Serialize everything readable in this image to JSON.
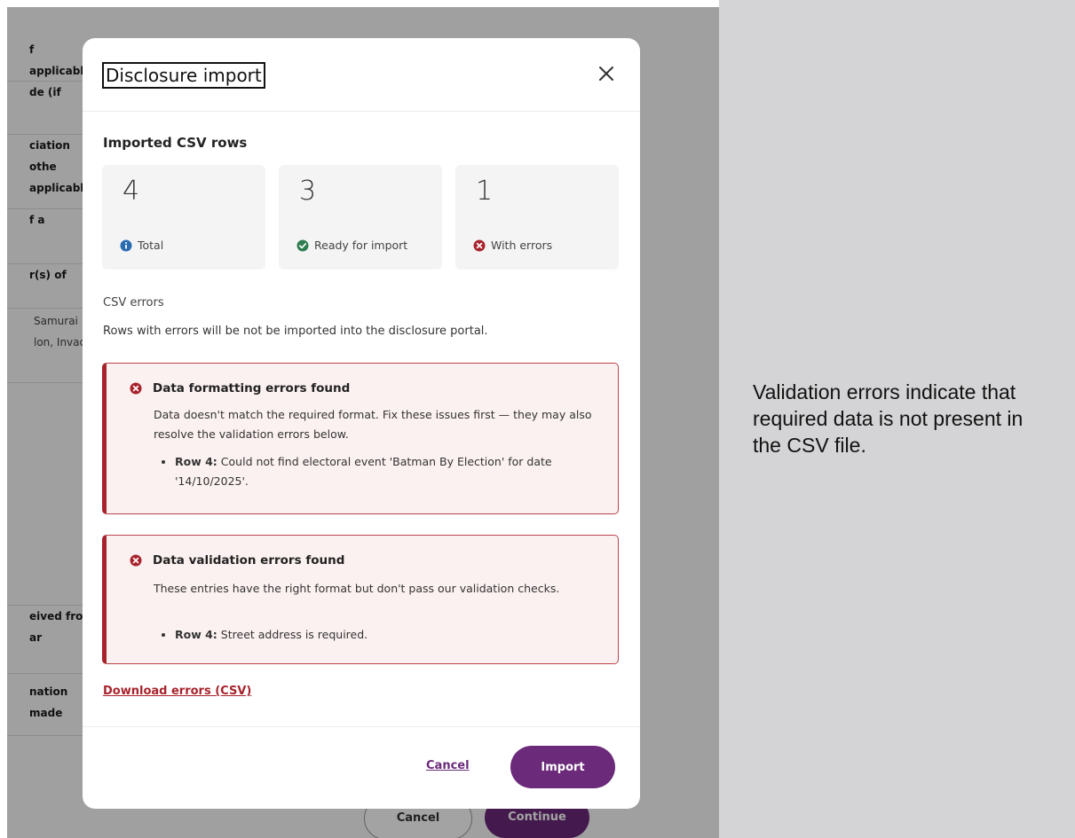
{
  "background_form": {
    "rows": [
      {
        "text": "f applicable)"
      },
      {
        "text": "de (if"
      },
      {
        "text": "ciation othe\n applicable)"
      },
      {
        "text": "f a"
      },
      {
        "text": "r(s) of"
      },
      {
        "text": "Samurai\nlon, Invade"
      },
      {
        "text": "eived from\nar"
      },
      {
        "text": "nation made"
      }
    ],
    "cancel_label": "Cancel",
    "continue_label": "Continue"
  },
  "modal": {
    "title": "Disclosure import",
    "section_heading": "Imported CSV rows",
    "stats": [
      {
        "value": "4",
        "label": "Total",
        "icon": "info-icon",
        "color": "#2b6cb0"
      },
      {
        "value": "3",
        "label": "Ready for import",
        "icon": "check-circle-icon",
        "color": "#2e7d4f"
      },
      {
        "value": "1",
        "label": "With errors",
        "icon": "error-circle-icon",
        "color": "#a8232c"
      }
    ],
    "csv_errors_label": "CSV errors",
    "csv_errors_description": "Rows with errors will be not be imported into the disclosure portal.",
    "formatting_error": {
      "title": "Data formatting errors found",
      "text": "Data doesn't match the required format. Fix these issues first — they may also resolve the validation errors below.",
      "items": [
        {
          "row": "Row 4:",
          "message": "Could not find electoral event 'Batman By Election' for date '14/10/2025'."
        }
      ]
    },
    "validation_error": {
      "title": "Data validation errors found",
      "text": "These entries have the right format but don't pass our validation checks.",
      "items": [
        {
          "row": "Row 4:",
          "message": "Street address is required."
        }
      ]
    },
    "download_link": "Download errors (CSV)",
    "cancel_label": "Cancel",
    "import_label": "Import"
  },
  "annotation": "Validation errors indicate that required data is not present in the CSV file.",
  "colors": {
    "brand_purple": "#6b2a7a",
    "error_red": "#a8232c",
    "error_bg": "#fcf1f1"
  }
}
